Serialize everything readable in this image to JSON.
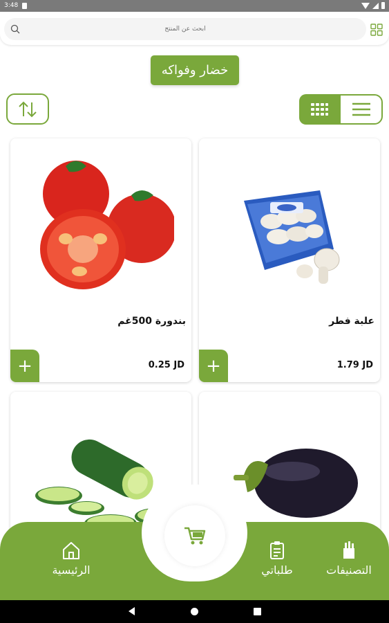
{
  "status_bar": {
    "time": "3:48"
  },
  "search": {
    "placeholder": "ابحث عن المنتج"
  },
  "category": {
    "title": "خضار وفواكه"
  },
  "products": [
    {
      "name": "علبة فطر",
      "price": "1.79 JD",
      "image": "mushroom-box"
    },
    {
      "name": "بندورة 500غم",
      "price": "0.25 JD",
      "image": "tomatoes"
    },
    {
      "name": "",
      "price": "",
      "image": "eggplant"
    },
    {
      "name": "",
      "price": "",
      "image": "cucumber"
    }
  ],
  "add_label": "+",
  "bottom_nav": {
    "categories": "التصنيفات",
    "orders": "طلباتي",
    "home": "الرئيسية"
  },
  "colors": {
    "accent": "#7aa83b"
  }
}
